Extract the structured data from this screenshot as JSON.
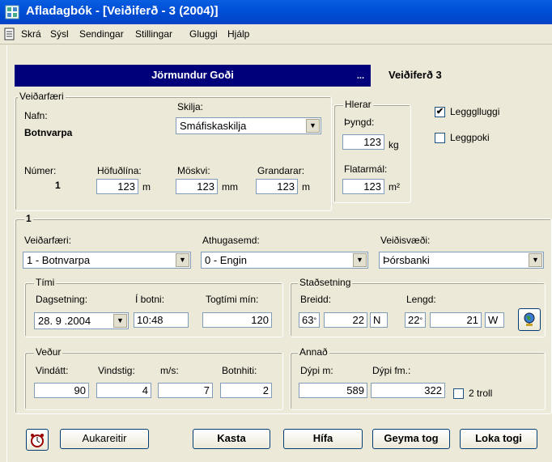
{
  "window": {
    "title": "Afladagbók - [Veiðiferð - 3 (2004)]"
  },
  "menu": [
    "Skrá",
    "Sýsl",
    "Sendingar",
    "Stillingar",
    "Gluggi",
    "Hjálp"
  ],
  "header": {
    "vessel_name": "Jörmundur Goði",
    "dots": "...",
    "trip_label": "Veiðiferð 3"
  },
  "gear": {
    "legend": "Veiðarfæri",
    "name_label": "Nafn:",
    "name_value": "Botnvarpa",
    "skilja_label": "Skilja:",
    "skilja_value": "Smáfiskaskilja",
    "number_label": "Númer:",
    "number_value": "1",
    "headline_label": "Höfuðlína:",
    "headline_value": "123",
    "headline_unit": "m",
    "mesh_label": "Möskvi:",
    "mesh_value": "123",
    "mesh_unit": "mm",
    "grandarar_label": "Grandarar:",
    "grandarar_value": "123",
    "grandarar_unit": "m"
  },
  "hlerar": {
    "legend": "Hlerar",
    "weight_label": "Þyngd:",
    "weight_value": "123",
    "weight_unit": "kg",
    "area_label": "Flatarmál:",
    "area_value": "123",
    "area_unit": "m²"
  },
  "checks": {
    "leggluggi_label": "Leggglluggi",
    "leggluggi_checked": true,
    "leggpoki_label": "Leggpoki",
    "leggpoki_checked": false,
    "troll_label": "2 troll",
    "troll_checked": false
  },
  "tow": {
    "legend": "1",
    "gear_label": "Veiðarfæri:",
    "gear_value": "1 - Botnvarpa",
    "remark_label": "Athugasemd:",
    "remark_value": "0 - Engin",
    "area_label": "Veiðisvæði:",
    "area_value": "Þórsbanki"
  },
  "time": {
    "legend": "Tími",
    "date_label": "Dagsetning:",
    "date_value": "28. 9 .2004",
    "bottom_label": "Í botni:",
    "bottom_value": "10:48",
    "towtime_label": "Togtími mín:",
    "towtime_value": "120"
  },
  "position": {
    "legend": "Staðsetning",
    "lat_label": "Breidd:",
    "lat_deg": "63",
    "lat_min": "22",
    "lat_hem": "N",
    "lon_label": "Lengd:",
    "lon_deg": "22",
    "lon_min": "21",
    "lon_hem": "W",
    "deg_sym": "°"
  },
  "weather": {
    "legend": "Veður",
    "dir_label": "Vindátt:",
    "dir_value": "90",
    "force_label": "Vindstig:",
    "force_value": "4",
    "ms_label": "m/s:",
    "ms_value": "7",
    "temp_label": "Botnhiti:",
    "temp_value": "2"
  },
  "other": {
    "legend": "Annað",
    "depth_label": "Dýpi m:",
    "depth_value": "589",
    "depthfm_label": "Dýpi fm.:",
    "depthfm_value": "322"
  },
  "buttons": {
    "extra": "Aukareitir",
    "kasta": "Kasta",
    "hifa": "Hífa",
    "geyma": "Geyma tog",
    "loka": "Loka togi"
  }
}
